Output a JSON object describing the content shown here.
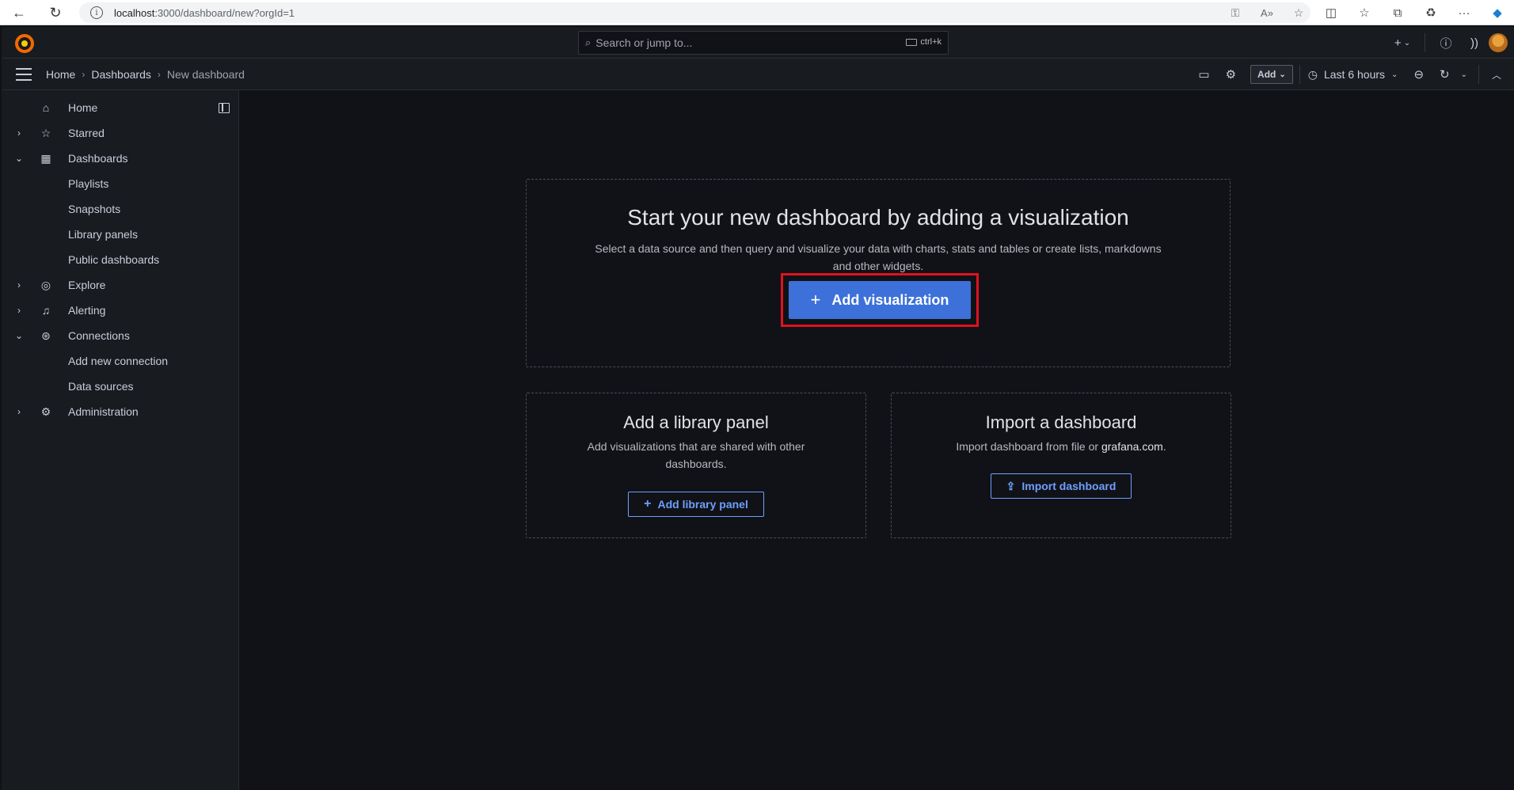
{
  "browser": {
    "url_host": "localhost",
    "url_path": ":3000/dashboard/new?orgId=1"
  },
  "topbar": {
    "search_placeholder": "Search or jump to...",
    "search_shortcut": "ctrl+k"
  },
  "breadcrumbs": [
    "Home",
    "Dashboards",
    "New dashboard"
  ],
  "toolbar": {
    "add_label": "Add",
    "time_range": "Last 6 hours"
  },
  "sidebar": {
    "items": [
      {
        "label": "Home",
        "icon": "home-icon",
        "chevron": ""
      },
      {
        "label": "Starred",
        "icon": "star-icon",
        "chevron": "›"
      },
      {
        "label": "Dashboards",
        "icon": "apps-icon",
        "chevron": "⌄"
      },
      {
        "label": "Playlists",
        "icon": "",
        "chevron": ""
      },
      {
        "label": "Snapshots",
        "icon": "",
        "chevron": ""
      },
      {
        "label": "Library panels",
        "icon": "",
        "chevron": ""
      },
      {
        "label": "Public dashboards",
        "icon": "",
        "chevron": ""
      },
      {
        "label": "Explore",
        "icon": "compass-icon",
        "chevron": "›"
      },
      {
        "label": "Alerting",
        "icon": "bell-icon",
        "chevron": "›"
      },
      {
        "label": "Connections",
        "icon": "link-icon",
        "chevron": "⌄"
      },
      {
        "label": "Add new connection",
        "icon": "",
        "chevron": ""
      },
      {
        "label": "Data sources",
        "icon": "",
        "chevron": ""
      },
      {
        "label": "Administration",
        "icon": "cog-icon",
        "chevron": "›"
      }
    ]
  },
  "main": {
    "hero_title": "Start your new dashboard by adding a visualization",
    "hero_text": "Select a data source and then query and visualize your data with charts, stats and tables or create lists, markdowns and other widgets.",
    "add_visualization_label": "Add visualization",
    "library": {
      "title": "Add a library panel",
      "text": "Add visualizations that are shared with other dashboards.",
      "button": "Add library panel"
    },
    "import": {
      "title": "Import a dashboard",
      "text_prefix": "Import dashboard from file or ",
      "link": "grafana.com",
      "text_suffix": ".",
      "button": "Import dashboard"
    }
  },
  "colors": {
    "primary": "#3d71d9",
    "highlight": "#e0121f",
    "link": "#6e9fff",
    "background": "#111217",
    "panel": "#181b1f"
  }
}
